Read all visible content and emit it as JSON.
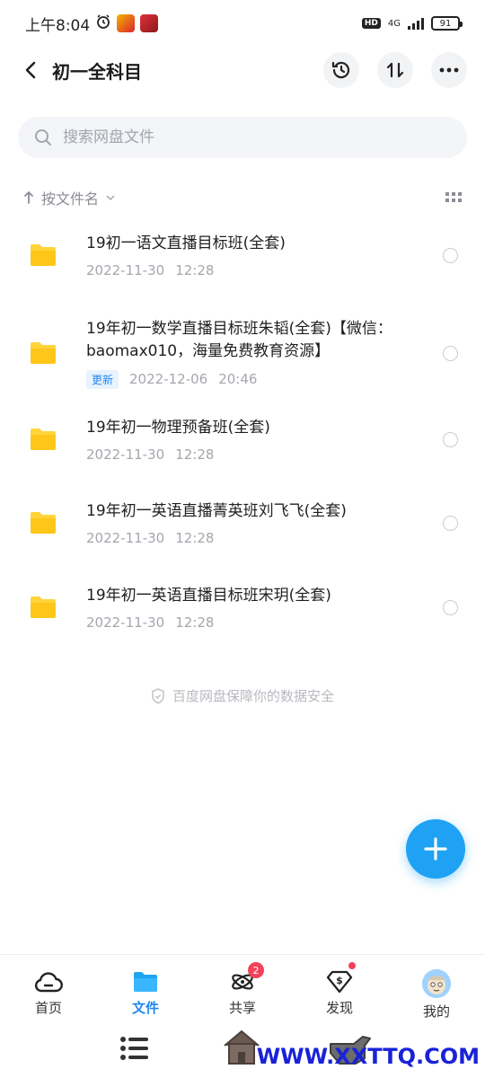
{
  "status_bar": {
    "time": "上午8:04",
    "network": "4G",
    "battery": "91"
  },
  "header": {
    "title": "初一全科目"
  },
  "search": {
    "placeholder": "搜索网盘文件"
  },
  "sort": {
    "label": "按文件名"
  },
  "files": [
    {
      "name": "19初一语文直播目标班(全套)",
      "date": "2022-11-30",
      "time": "12:28",
      "badge": ""
    },
    {
      "name": "19年初一数学直播目标班朱韬(全套)【微信：baomax010，海量免费教育资源】",
      "date": "2022-12-06",
      "time": "20:46",
      "badge": "更新"
    },
    {
      "name": "19年初一物理预备班(全套)",
      "date": "2022-11-30",
      "time": "12:28",
      "badge": ""
    },
    {
      "name": "19年初一英语直播菁英班刘飞飞(全套)",
      "date": "2022-11-30",
      "time": "12:28",
      "badge": ""
    },
    {
      "name": "19年初一英语直播目标班宋玥(全套)",
      "date": "2022-11-30",
      "time": "12:28",
      "badge": ""
    }
  ],
  "security_note": "百度网盘保障你的数据安全",
  "bottom_nav": {
    "items": [
      {
        "label": "首页",
        "icon": "home-cloud-icon"
      },
      {
        "label": "文件",
        "icon": "folder-icon"
      },
      {
        "label": "共享",
        "icon": "atom-icon",
        "badge": "2"
      },
      {
        "label": "发现",
        "icon": "diamond-dollar-icon"
      },
      {
        "label": "我的",
        "icon": "avatar"
      }
    ]
  },
  "watermark": "WWW.XXTTQ.COM",
  "colors": {
    "accent": "#1e86f0",
    "fab": "#1fa2f3",
    "folder": "#ffd43b",
    "badge": "#f2435a"
  }
}
